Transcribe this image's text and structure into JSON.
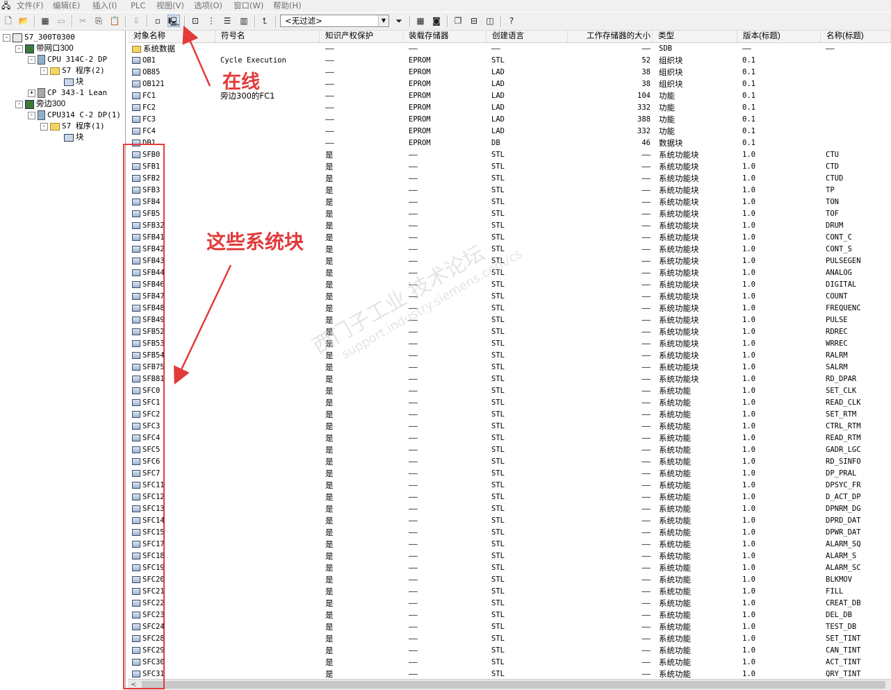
{
  "menu": [
    "文件(F)",
    "编辑(E)",
    "插入(I)",
    "PLC",
    "视图(V)",
    "选项(O)",
    "窗口(W)",
    "帮助(H)"
  ],
  "toolbar": {
    "filter_value": "<无过滤>"
  },
  "tree": [
    {
      "label": "S7_300T0300",
      "expander": "-",
      "icon": "project-icon"
    },
    {
      "label": "带网口300",
      "expander": "-",
      "icon": "station-icon"
    },
    {
      "label": "CPU 314C-2 DP",
      "expander": "-",
      "icon": "cpu-icon"
    },
    {
      "label": "S7 程序(2)",
      "expander": "-",
      "icon": "folder-icon"
    },
    {
      "label": "块",
      "expander": "",
      "icon": "blocks-icon"
    },
    {
      "label": "CP 343-1 Lean",
      "expander": "+",
      "icon": "cp-icon"
    },
    {
      "label": "旁边300",
      "expander": "-",
      "icon": "station-icon"
    },
    {
      "label": "CPU314 C-2 DP(1)",
      "expander": "-",
      "icon": "cpu-icon"
    },
    {
      "label": "S7 程序(1)",
      "expander": "-",
      "icon": "folder-icon"
    },
    {
      "label": "块",
      "expander": "",
      "icon": "blocks-icon"
    }
  ],
  "columns": [
    "对象名称",
    "符号名",
    "知识产权保护",
    "装载存储器",
    "创建语言",
    "工作存储器的大小",
    "类型",
    "版本(标题)",
    "名称(标题)"
  ],
  "rows": [
    [
      "系统数据",
      "",
      "——",
      "——",
      "——",
      "——",
      "SDB",
      "——",
      "——"
    ],
    [
      "OB1",
      "Cycle Execution",
      "——",
      "EPROM",
      "STL",
      "52",
      "组织块",
      "0.1",
      ""
    ],
    [
      "OB85",
      "",
      "——",
      "EPROM",
      "LAD",
      "38",
      "组织块",
      "0.1",
      ""
    ],
    [
      "OB121",
      "",
      "——",
      "EPROM",
      "LAD",
      "38",
      "组织块",
      "0.1",
      ""
    ],
    [
      "FC1",
      "旁边300的FC1",
      "——",
      "EPROM",
      "LAD",
      "104",
      "功能",
      "0.1",
      ""
    ],
    [
      "FC2",
      "",
      "——",
      "EPROM",
      "LAD",
      "332",
      "功能",
      "0.1",
      ""
    ],
    [
      "FC3",
      "",
      "——",
      "EPROM",
      "LAD",
      "388",
      "功能",
      "0.1",
      ""
    ],
    [
      "FC4",
      "",
      "——",
      "EPROM",
      "LAD",
      "332",
      "功能",
      "0.1",
      ""
    ],
    [
      "DB1",
      "",
      "——",
      "EPROM",
      "DB",
      "46",
      "数据块",
      "0.1",
      ""
    ],
    [
      "SFB0",
      "",
      "是",
      "——",
      "STL",
      "——",
      "系统功能块",
      "1.0",
      "CTU"
    ],
    [
      "SFB1",
      "",
      "是",
      "——",
      "STL",
      "——",
      "系统功能块",
      "1.0",
      "CTD"
    ],
    [
      "SFB2",
      "",
      "是",
      "——",
      "STL",
      "——",
      "系统功能块",
      "1.0",
      "CTUD"
    ],
    [
      "SFB3",
      "",
      "是",
      "——",
      "STL",
      "——",
      "系统功能块",
      "1.0",
      "TP"
    ],
    [
      "SFB4",
      "",
      "是",
      "——",
      "STL",
      "——",
      "系统功能块",
      "1.0",
      "TON"
    ],
    [
      "SFB5",
      "",
      "是",
      "——",
      "STL",
      "——",
      "系统功能块",
      "1.0",
      "TOF"
    ],
    [
      "SFB32",
      "",
      "是",
      "——",
      "STL",
      "——",
      "系统功能块",
      "1.0",
      "DRUM"
    ],
    [
      "SFB41",
      "",
      "是",
      "——",
      "STL",
      "——",
      "系统功能块",
      "1.0",
      "CONT_C"
    ],
    [
      "SFB42",
      "",
      "是",
      "——",
      "STL",
      "——",
      "系统功能块",
      "1.0",
      "CONT_S"
    ],
    [
      "SFB43",
      "",
      "是",
      "——",
      "STL",
      "——",
      "系统功能块",
      "1.0",
      "PULSEGEN"
    ],
    [
      "SFB44",
      "",
      "是",
      "——",
      "STL",
      "——",
      "系统功能块",
      "1.0",
      "ANALOG"
    ],
    [
      "SFB46",
      "",
      "是",
      "——",
      "STL",
      "——",
      "系统功能块",
      "1.0",
      "DIGITAL"
    ],
    [
      "SFB47",
      "",
      "是",
      "——",
      "STL",
      "——",
      "系统功能块",
      "1.0",
      "COUNT"
    ],
    [
      "SFB48",
      "",
      "是",
      "——",
      "STL",
      "——",
      "系统功能块",
      "1.0",
      "FREQUENC"
    ],
    [
      "SFB49",
      "",
      "是",
      "——",
      "STL",
      "——",
      "系统功能块",
      "1.0",
      "PULSE"
    ],
    [
      "SFB52",
      "",
      "是",
      "——",
      "STL",
      "——",
      "系统功能块",
      "1.0",
      "RDREC"
    ],
    [
      "SFB53",
      "",
      "是",
      "——",
      "STL",
      "——",
      "系统功能块",
      "1.0",
      "WRREC"
    ],
    [
      "SFB54",
      "",
      "是",
      "——",
      "STL",
      "——",
      "系统功能块",
      "1.0",
      "RALRM"
    ],
    [
      "SFB75",
      "",
      "是",
      "——",
      "STL",
      "——",
      "系统功能块",
      "1.0",
      "SALRM"
    ],
    [
      "SFB81",
      "",
      "是",
      "——",
      "STL",
      "——",
      "系统功能块",
      "1.0",
      "RD_DPAR"
    ],
    [
      "SFC0",
      "",
      "是",
      "——",
      "STL",
      "——",
      "系统功能",
      "1.0",
      "SET_CLK"
    ],
    [
      "SFC1",
      "",
      "是",
      "——",
      "STL",
      "——",
      "系统功能",
      "1.0",
      "READ_CLK"
    ],
    [
      "SFC2",
      "",
      "是",
      "——",
      "STL",
      "——",
      "系统功能",
      "1.0",
      "SET_RTM"
    ],
    [
      "SFC3",
      "",
      "是",
      "——",
      "STL",
      "——",
      "系统功能",
      "1.0",
      "CTRL_RTM"
    ],
    [
      "SFC4",
      "",
      "是",
      "——",
      "STL",
      "——",
      "系统功能",
      "1.0",
      "READ_RTM"
    ],
    [
      "SFC5",
      "",
      "是",
      "——",
      "STL",
      "——",
      "系统功能",
      "1.0",
      "GADR_LGC"
    ],
    [
      "SFC6",
      "",
      "是",
      "——",
      "STL",
      "——",
      "系统功能",
      "1.0",
      "RD_SINFO"
    ],
    [
      "SFC7",
      "",
      "是",
      "——",
      "STL",
      "——",
      "系统功能",
      "1.0",
      "DP_PRAL"
    ],
    [
      "SFC11",
      "",
      "是",
      "——",
      "STL",
      "——",
      "系统功能",
      "1.0",
      "DPSYC_FR"
    ],
    [
      "SFC12",
      "",
      "是",
      "——",
      "STL",
      "——",
      "系统功能",
      "1.0",
      "D_ACT_DP"
    ],
    [
      "SFC13",
      "",
      "是",
      "——",
      "STL",
      "——",
      "系统功能",
      "1.0",
      "DPNRM_DG"
    ],
    [
      "SFC14",
      "",
      "是",
      "——",
      "STL",
      "——",
      "系统功能",
      "1.0",
      "DPRD_DAT"
    ],
    [
      "SFC15",
      "",
      "是",
      "——",
      "STL",
      "——",
      "系统功能",
      "1.0",
      "DPWR_DAT"
    ],
    [
      "SFC17",
      "",
      "是",
      "——",
      "STL",
      "——",
      "系统功能",
      "1.0",
      "ALARM_SQ"
    ],
    [
      "SFC18",
      "",
      "是",
      "——",
      "STL",
      "——",
      "系统功能",
      "1.0",
      "ALARM_S"
    ],
    [
      "SFC19",
      "",
      "是",
      "——",
      "STL",
      "——",
      "系统功能",
      "1.0",
      "ALARM_SC"
    ],
    [
      "SFC20",
      "",
      "是",
      "——",
      "STL",
      "——",
      "系统功能",
      "1.0",
      "BLKMOV"
    ],
    [
      "SFC21",
      "",
      "是",
      "——",
      "STL",
      "——",
      "系统功能",
      "1.0",
      "FILL"
    ],
    [
      "SFC22",
      "",
      "是",
      "——",
      "STL",
      "——",
      "系统功能",
      "1.0",
      "CREAT_DB"
    ],
    [
      "SFC23",
      "",
      "是",
      "——",
      "STL",
      "——",
      "系统功能",
      "1.0",
      "DEL_DB"
    ],
    [
      "SFC24",
      "",
      "是",
      "——",
      "STL",
      "——",
      "系统功能",
      "1.0",
      "TEST_DB"
    ],
    [
      "SFC28",
      "",
      "是",
      "——",
      "STL",
      "——",
      "系统功能",
      "1.0",
      "SET_TINT"
    ],
    [
      "SFC29",
      "",
      "是",
      "——",
      "STL",
      "——",
      "系统功能",
      "1.0",
      "CAN_TINT"
    ],
    [
      "SFC30",
      "",
      "是",
      "——",
      "STL",
      "——",
      "系统功能",
      "1.0",
      "ACT_TINT"
    ],
    [
      "SFC31",
      "",
      "是",
      "——",
      "STL",
      "——",
      "系统功能",
      "1.0",
      "QRY_TINT"
    ]
  ],
  "annotations": {
    "online": "在线",
    "system_blocks": "这些系统块"
  },
  "watermark": {
    "line1": "西门子工业 技术论坛",
    "line2": "support.industry.siemens.com/cs"
  },
  "colors": {
    "annotation": "#e23a3a",
    "grid_border": "#cfcfcf"
  }
}
